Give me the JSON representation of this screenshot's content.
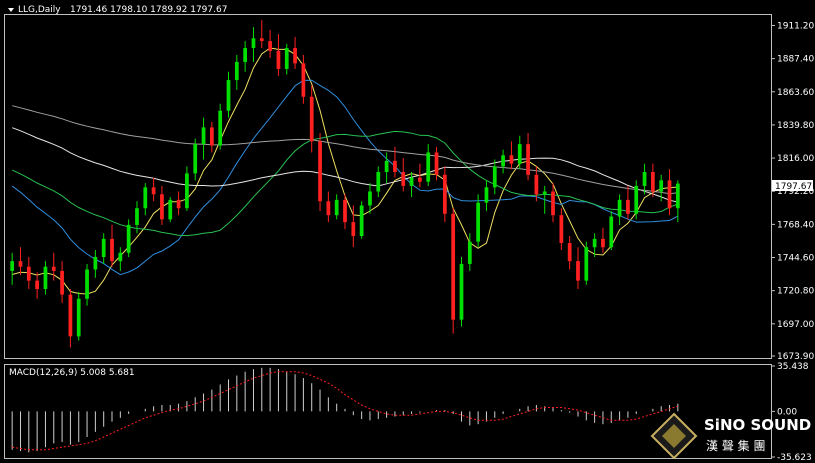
{
  "header": {
    "symbol": "LLG,Daily",
    "ohlc": "1791.46 1798.10 1789.92 1797.67"
  },
  "macd_header": "MACD(12,26,9) 5.008 5.681",
  "current_price_label": "1797.67",
  "colors": {
    "background": "#000000",
    "bull": "#00e000",
    "bear": "#ff2020",
    "ma_yellow": "#f0e060",
    "ma_blue": "#2e8fe0",
    "ma_green": "#28c050",
    "ma_white": "#e6e6e6",
    "ma_grey": "#a0a0a0",
    "macd_signal": "#ff2020",
    "macd_hist": "#d0d0d0",
    "axis": "#c0c0c0"
  },
  "watermark": {
    "brand": "SiNO SOUND",
    "chinese": "漢 聲 集 團"
  },
  "chart_data": [
    {
      "type": "candlestick",
      "y_ticks": [
        "1911.20",
        "1887.40",
        "1863.60",
        "1839.80",
        "1816.00",
        "1792.20",
        "1768.40",
        "1744.60",
        "1720.80",
        "1697.00",
        "1673.90"
      ],
      "ylim": [
        1673.9,
        1918
      ],
      "ohlc": [
        [
          1735,
          1748,
          1725,
          1742
        ],
        [
          1742,
          1752,
          1732,
          1738
        ],
        [
          1738,
          1745,
          1722,
          1728
        ],
        [
          1728,
          1734,
          1715,
          1722
        ],
        [
          1722,
          1742,
          1718,
          1738
        ],
        [
          1738,
          1748,
          1728,
          1735
        ],
        [
          1735,
          1742,
          1712,
          1718
        ],
        [
          1718,
          1722,
          1680,
          1688
        ],
        [
          1688,
          1720,
          1685,
          1715
        ],
        [
          1715,
          1740,
          1710,
          1736
        ],
        [
          1736,
          1750,
          1730,
          1745
        ],
        [
          1745,
          1762,
          1740,
          1758
        ],
        [
          1758,
          1768,
          1738,
          1742
        ],
        [
          1742,
          1752,
          1735,
          1748
        ],
        [
          1748,
          1772,
          1745,
          1768
        ],
        [
          1768,
          1785,
          1762,
          1780
        ],
        [
          1780,
          1798,
          1775,
          1795
        ],
        [
          1795,
          1802,
          1785,
          1790
        ],
        [
          1790,
          1796,
          1768,
          1772
        ],
        [
          1772,
          1788,
          1770,
          1786
        ],
        [
          1786,
          1792,
          1775,
          1780
        ],
        [
          1780,
          1810,
          1778,
          1805
        ],
        [
          1805,
          1830,
          1800,
          1826
        ],
        [
          1826,
          1845,
          1815,
          1838
        ],
        [
          1838,
          1842,
          1820,
          1825
        ],
        [
          1825,
          1855,
          1822,
          1850
        ],
        [
          1850,
          1878,
          1845,
          1872
        ],
        [
          1872,
          1890,
          1865,
          1885
        ],
        [
          1885,
          1900,
          1878,
          1895
        ],
        [
          1895,
          1910,
          1885,
          1902
        ],
        [
          1902,
          1915,
          1895,
          1900
        ],
        [
          1900,
          1908,
          1888,
          1893
        ],
        [
          1893,
          1905,
          1875,
          1880
        ],
        [
          1880,
          1898,
          1876,
          1895
        ],
        [
          1895,
          1903,
          1880,
          1884
        ],
        [
          1884,
          1890,
          1855,
          1860
        ],
        [
          1860,
          1868,
          1820,
          1828
        ],
        [
          1828,
          1834,
          1778,
          1785
        ],
        [
          1785,
          1792,
          1770,
          1775
        ],
        [
          1775,
          1790,
          1772,
          1786
        ],
        [
          1786,
          1790,
          1765,
          1770
        ],
        [
          1770,
          1782,
          1752,
          1760
        ],
        [
          1760,
          1785,
          1758,
          1782
        ],
        [
          1782,
          1798,
          1776,
          1792
        ],
        [
          1792,
          1810,
          1788,
          1806
        ],
        [
          1806,
          1820,
          1798,
          1814
        ],
        [
          1814,
          1824,
          1802,
          1806
        ],
        [
          1806,
          1816,
          1792,
          1796
        ],
        [
          1796,
          1806,
          1788,
          1802
        ],
        [
          1802,
          1812,
          1795,
          1799
        ],
        [
          1799,
          1826,
          1796,
          1820
        ],
        [
          1820,
          1824,
          1800,
          1804
        ],
        [
          1804,
          1810,
          1770,
          1776
        ],
        [
          1776,
          1780,
          1690,
          1700
        ],
        [
          1700,
          1745,
          1695,
          1740
        ],
        [
          1740,
          1762,
          1735,
          1756
        ],
        [
          1756,
          1790,
          1752,
          1784
        ],
        [
          1784,
          1800,
          1778,
          1795
        ],
        [
          1795,
          1815,
          1790,
          1810
        ],
        [
          1810,
          1822,
          1805,
          1818
        ],
        [
          1818,
          1828,
          1808,
          1812
        ],
        [
          1812,
          1832,
          1808,
          1826
        ],
        [
          1826,
          1834,
          1800,
          1804
        ],
        [
          1804,
          1810,
          1785,
          1790
        ],
        [
          1790,
          1796,
          1776,
          1792
        ],
        [
          1792,
          1798,
          1770,
          1775
        ],
        [
          1775,
          1780,
          1750,
          1755
        ],
        [
          1755,
          1760,
          1736,
          1742
        ],
        [
          1742,
          1752,
          1722,
          1728
        ],
        [
          1728,
          1756,
          1725,
          1752
        ],
        [
          1752,
          1762,
          1745,
          1758
        ],
        [
          1758,
          1766,
          1748,
          1752
        ],
        [
          1752,
          1778,
          1750,
          1774
        ],
        [
          1774,
          1790,
          1768,
          1786
        ],
        [
          1786,
          1796,
          1772,
          1776
        ],
        [
          1776,
          1800,
          1772,
          1796
        ],
        [
          1796,
          1812,
          1790,
          1806
        ],
        [
          1806,
          1812,
          1788,
          1792
        ],
        [
          1792,
          1804,
          1785,
          1800
        ],
        [
          1800,
          1808,
          1775,
          1780
        ],
        [
          1780,
          1800,
          1770,
          1797.67
        ]
      ]
    },
    {
      "type": "macd",
      "y_ticks": [
        "35.438",
        "0.00",
        "-35.623"
      ],
      "ylim": [
        -35.623,
        35.438
      ],
      "histogram": [
        -30,
        -31,
        -32,
        -31,
        -28,
        -25,
        -24,
        -26,
        -24,
        -20,
        -16,
        -12,
        -8,
        -5,
        -2,
        0,
        2,
        4,
        5,
        5,
        6,
        8,
        11,
        14,
        17,
        21,
        25,
        28,
        31,
        33,
        34,
        34,
        33,
        31,
        29,
        26,
        22,
        17,
        11,
        6,
        2,
        -3,
        -6,
        -7,
        -6,
        -5,
        -4,
        -3,
        -2,
        -1,
        0,
        1,
        1,
        -2,
        -8,
        -11,
        -10,
        -8,
        -5,
        -2,
        0,
        2,
        4,
        5,
        4,
        3,
        1,
        -1,
        -4,
        -7,
        -9,
        -10,
        -9,
        -7,
        -5,
        -2,
        0,
        2,
        4,
        5,
        6
      ],
      "signal": [
        -28,
        -29,
        -30,
        -30,
        -30,
        -29,
        -28,
        -27,
        -26,
        -25,
        -23,
        -20,
        -17,
        -14,
        -11,
        -8,
        -5,
        -3,
        -1,
        1,
        2,
        4,
        6,
        8,
        11,
        14,
        17,
        20,
        23,
        26,
        28,
        30,
        31,
        31,
        31,
        30,
        28,
        25,
        22,
        18,
        13,
        9,
        5,
        2,
        0,
        -2,
        -3,
        -3,
        -3,
        -2,
        -1,
        0,
        0,
        -1,
        -3,
        -5,
        -7,
        -7,
        -7,
        -6,
        -4,
        -2,
        0,
        2,
        3,
        3,
        3,
        2,
        1,
        -1,
        -3,
        -5,
        -7,
        -7,
        -7,
        -6,
        -4,
        -2,
        0,
        2,
        4
      ]
    }
  ]
}
